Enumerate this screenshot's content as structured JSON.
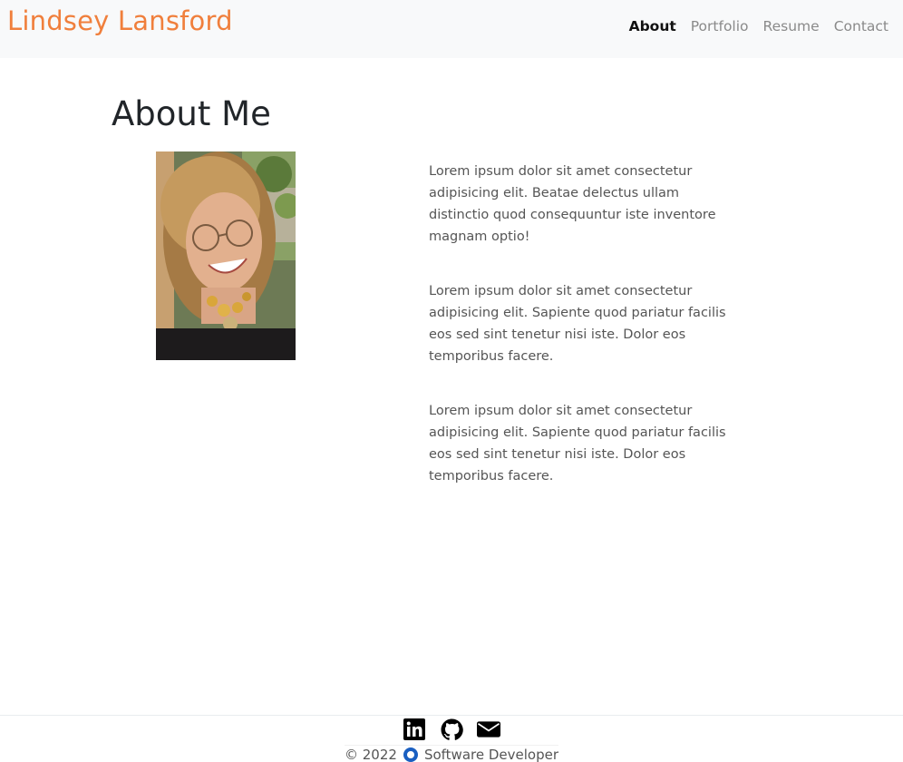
{
  "header": {
    "brand": "Lindsey Lansford",
    "nav": [
      {
        "label": "About",
        "active": true
      },
      {
        "label": "Portfolio",
        "active": false
      },
      {
        "label": "Resume",
        "active": false
      },
      {
        "label": "Contact",
        "active": false
      }
    ]
  },
  "main": {
    "title": "About Me",
    "photo_icon": "portrait-photo",
    "paragraphs": [
      "Lorem ipsum dolor sit amet consectetur adipisicing elit. Beatae delectus ullam distinctio quod consequuntur iste inventore magnam optio!",
      "Lorem ipsum dolor sit amet consectetur adipisicing elit. Sapiente quod pariatur facilis eos sed sint tenetur nisi iste. Dolor eos temporibus facere.",
      "Lorem ipsum dolor sit amet consectetur adipisicing elit. Sapiente quod pariatur facilis eos sed sint tenetur nisi iste. Dolor eos temporibus facere."
    ]
  },
  "footer": {
    "socials": [
      "linkedin-icon",
      "github-icon",
      "envelope-icon"
    ],
    "copyright": "© 2022",
    "tagline": "Software Developer"
  },
  "colors": {
    "brand": "#f07f3c",
    "nav_bg": "#f8f9fa",
    "accent_dot": "#1a5fc1"
  }
}
